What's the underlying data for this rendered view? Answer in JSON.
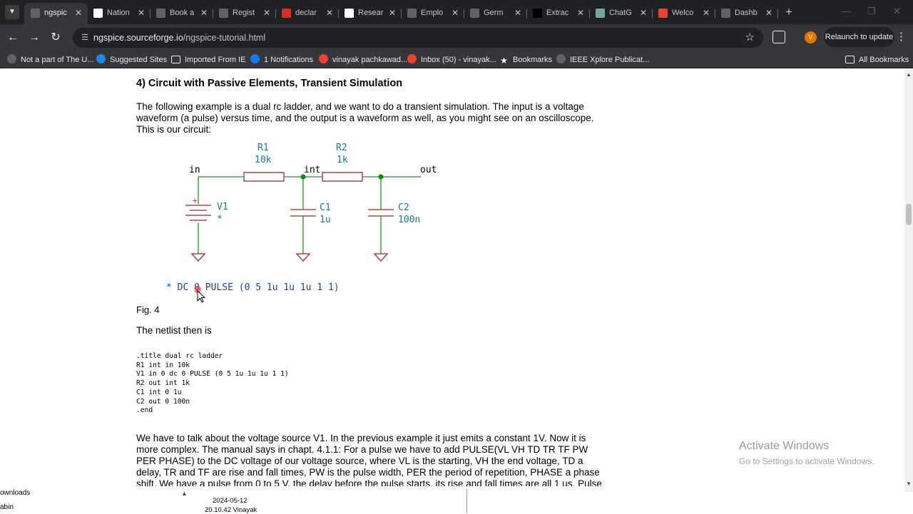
{
  "browser": {
    "tabs": [
      {
        "title": "ngspic",
        "favicon": "sourceforge-icon",
        "color": "#5f6368",
        "active": true
      },
      {
        "title": "Nation",
        "favicon": "ieee-icon",
        "color": "#ffffff"
      },
      {
        "title": "Book a",
        "favicon": "webex-icon",
        "color": "#5f6368"
      },
      {
        "title": "Regist",
        "favicon": "registration-icon",
        "color": "#5f6368"
      },
      {
        "title": "declar",
        "favicon": "pdf-icon",
        "color": "#d93025"
      },
      {
        "title": "Resear",
        "favicon": "research-icon",
        "color": "#ffffff"
      },
      {
        "title": "Emplo",
        "favicon": "employment-icon",
        "color": "#5f6368"
      },
      {
        "title": "Germ",
        "favicon": "germany-icon",
        "color": "#5f6368"
      },
      {
        "title": "Extrac",
        "favicon": "extract-icon",
        "color": "#000000"
      },
      {
        "title": "ChatG",
        "favicon": "chatgpt-icon",
        "color": "#74aa9c"
      },
      {
        "title": "Welco",
        "favicon": "gmail-icon",
        "color": "#ea4335"
      },
      {
        "title": "Dashb",
        "favicon": "dashboard-icon",
        "color": "#5f6368"
      }
    ],
    "url_host": "ngspice.sourceforge.io",
    "url_path": "/ngspice-tutorial.html",
    "avatar_letter": "V",
    "relaunch_label": "Relaunch to update",
    "bookmarks": [
      {
        "label": "Not a part of The U...",
        "icon": "globe-icon",
        "color": "#5f6368"
      },
      {
        "label": "Suggested Sites",
        "icon": "ie-icon",
        "color": "#1e88e5"
      },
      {
        "label": "Imported From IE",
        "icon": "folder-icon",
        "color": "#35363a"
      },
      {
        "label": "1 Notifications",
        "icon": "facebook-icon",
        "color": "#1877f2"
      },
      {
        "label": "vinayak pachkawad...",
        "icon": "gmail-icon",
        "color": "#ea4335"
      },
      {
        "label": "Inbox (50) - vinayak...",
        "icon": "gmail-icon",
        "color": "#ea4335"
      },
      {
        "label": "Bookmarks",
        "icon": "star-icon",
        "color": "#35363a"
      },
      {
        "label": "IEEE Xplore Publicat...",
        "icon": "globe-icon",
        "color": "#5f6368"
      }
    ],
    "all_bookmarks_label": "All Bookmarks"
  },
  "page": {
    "heading": "4) Circuit with Passive Elements, Transient Simulation",
    "intro_lines": [
      "The following example is a dual rc ladder, and we want to do a transient simulation. The input is a voltage",
      "waveform (a pulse) versus time, and the output is a waveform as well, as you might see on an oscilloscope.",
      "This is our circuit:"
    ],
    "circuit": {
      "in_label": "in",
      "int_label": "int",
      "out_label": "out",
      "r1_name": "R1",
      "r1_value": "10k",
      "r2_name": "R2",
      "r2_value": "1k",
      "v1_name": "V1",
      "v1_value": "*",
      "c1_name": "C1",
      "c1_value": "1u",
      "c2_name": "C2",
      "c2_value": "100n",
      "plus_sign": "+",
      "source_spec": "* DC 0 PULSE (0 5 1u 1u 1u 1 1)"
    },
    "fig_caption": "Fig. 4",
    "netlist_intro": "The netlist then is",
    "netlist": [
      ".title dual rc ladder",
      "R1 int in 10k",
      "V1 in 0 dc 0 PULSE (0 5 1u 1u 1u 1 1)",
      "R2 out int 1k",
      "C1 int 0 1u",
      "C2 out 0 100n",
      ".end"
    ],
    "body_lines": [
      "We have to talk about the voltage source V1. In the previous example it just emits a constant 1V. Now it is",
      "more complex. The manual says in chapt. 4.1.1: For a pulse we have to add PULSE(VL VH TD TR TF PW",
      "PER PHASE) to the DC voltage of our voltage source, where VL is the starting, VH the end voltage, TD a",
      "delay, TR and TF are rise and fall times, PW is the pulse width, PER the period of repetition, PHASE a phase",
      "shift. We have a pulse from 0 to 5 V, the delay before the pulse starts, its rise and fall times are all 1 us. Pulse"
    ]
  },
  "overlay": {
    "watermark_title": "Activate Windows",
    "watermark_sub": "Go to Settings to activate Windows.",
    "left_text_1": "ownloads",
    "left_text_2": "abin",
    "date": "2024-05-12",
    "time_user": "20.10.42 Vinayak"
  }
}
